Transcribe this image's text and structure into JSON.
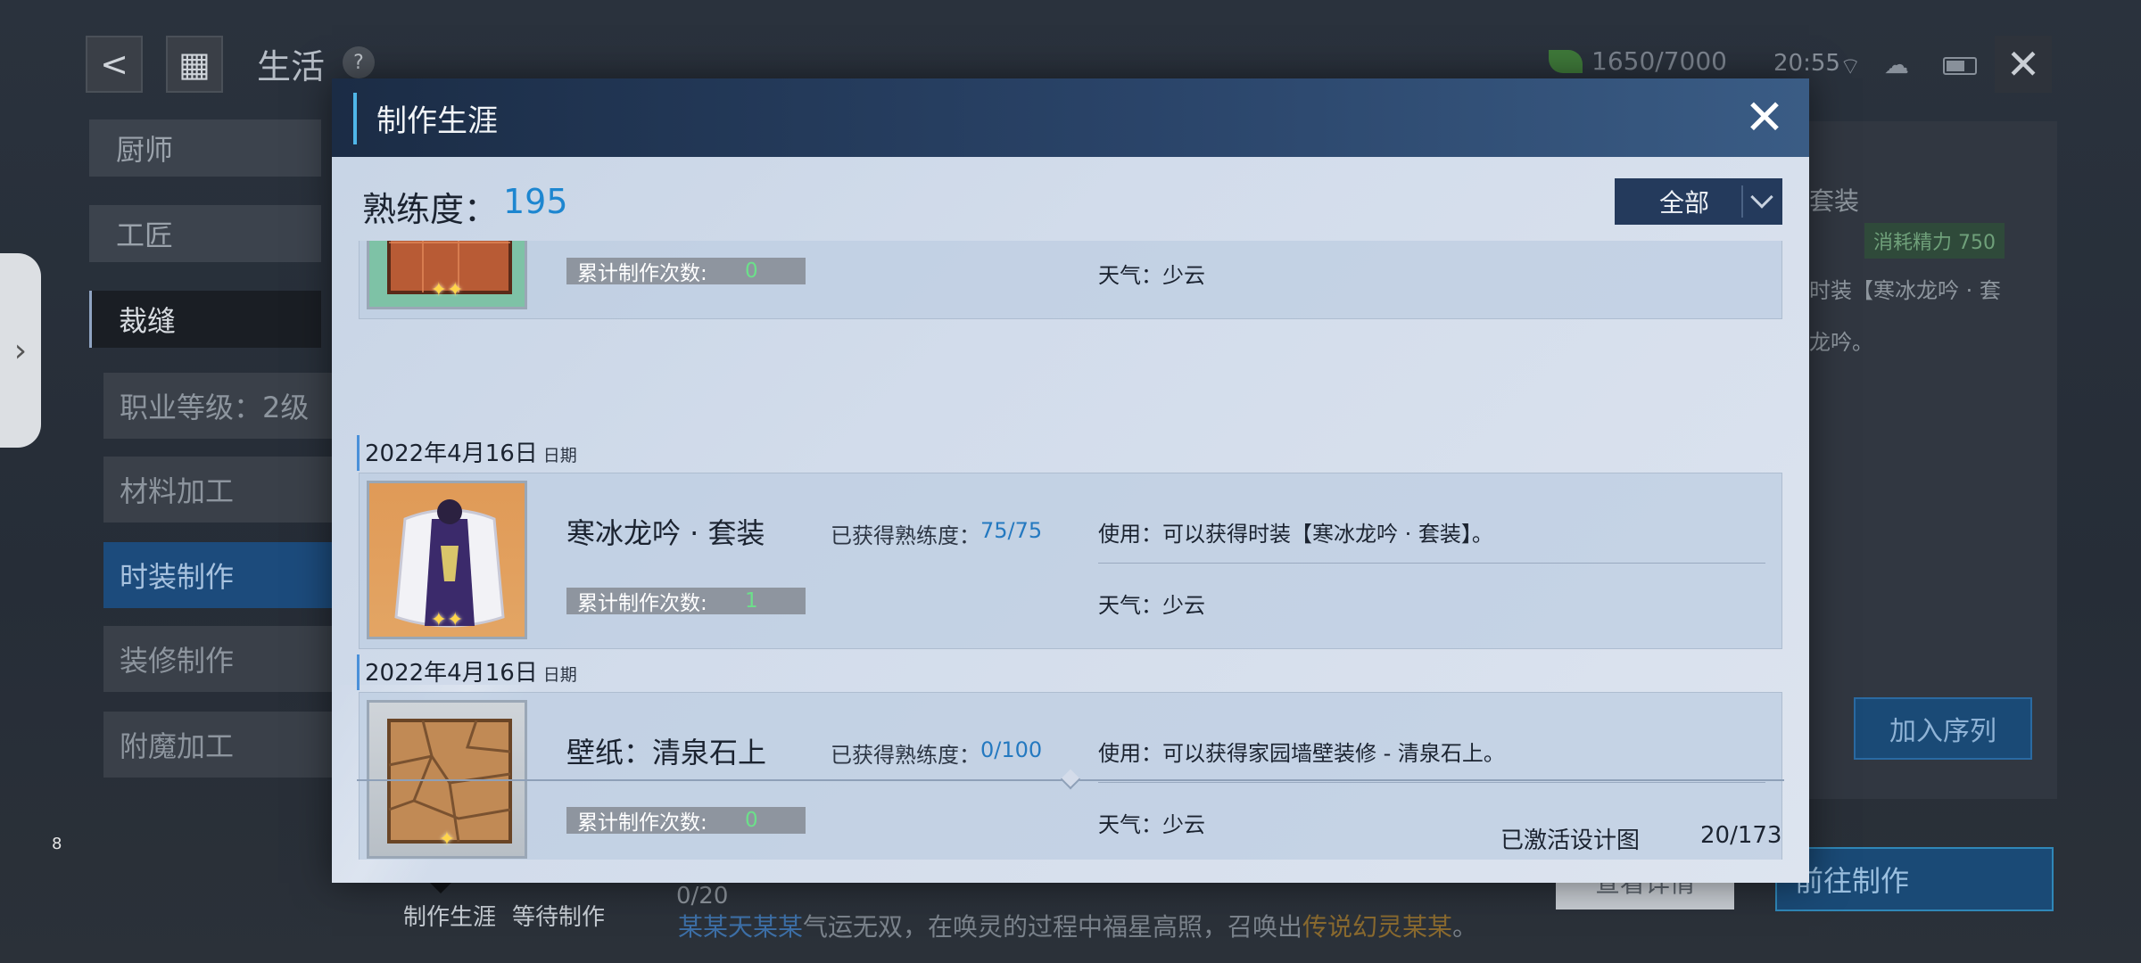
{
  "background": {
    "header": {
      "title": "生活",
      "help": "?",
      "energy": "1650/7000",
      "time": "20:55",
      "back_glyph": "<",
      "menu_glyph": "▦",
      "close_glyph": "✕"
    },
    "left_tabs": [
      {
        "label": "厨师"
      },
      {
        "label": "工匠"
      },
      {
        "label": "裁缝"
      }
    ],
    "left_subs": [
      {
        "label": "职业等级：2级"
      },
      {
        "label": "材料加工"
      },
      {
        "label": "时装制作"
      },
      {
        "label": "装修制作"
      },
      {
        "label": "附魔加工"
      }
    ],
    "side_handle_glyph": "›",
    "page_number": "8",
    "right_panel": {
      "title_fragment": "套装",
      "cost_label": "消耗精力 750",
      "desc_1": "时装【寒冰龙吟 · 套",
      "desc_2": "龙吟。",
      "add_queue": "加入序列",
      "go_make": "前往制作",
      "view_detail": "查看详情"
    },
    "bottom": {
      "tab_career": "制作生涯",
      "tab_waiting": "等待制作",
      "queue": "0/20",
      "ticker_parts": [
        "某某天某某",
        "气运无双，在唤灵的过程中福星高照，召唤出",
        "传说幻灵",
        "某某",
        "。"
      ]
    }
  },
  "modal": {
    "title": "制作生涯",
    "close_glyph": "✕",
    "proficiency_label": "熟练度：",
    "proficiency_value": "195",
    "filter_value": "全部",
    "entries": [
      {
        "date": "",
        "name": "",
        "gained_label": "",
        "gained_value": "",
        "use": "",
        "count_label": "累计制作次数:",
        "count_value": "0",
        "weather": "天气：少云",
        "stars": "✦✦"
      },
      {
        "date": "2022年4月16日",
        "date_suffix": "日期",
        "name": "寒冰龙吟 · 套装",
        "gained_label": "已获得熟练度：",
        "gained_value": "75/75",
        "use": "使用：可以获得时装【寒冰龙吟 · 套装】。",
        "count_label": "累计制作次数:",
        "count_value": "1",
        "weather": "天气：少云",
        "stars": "✦✦"
      },
      {
        "date": "2022年4月16日",
        "date_suffix": "日期",
        "name": "壁纸：清泉石上",
        "gained_label": "已获得熟练度：",
        "gained_value": "0/100",
        "use": "使用：可以获得家园墙壁装修 - 清泉石上。",
        "count_label": "累计制作次数:",
        "count_value": "0",
        "weather": "天气：少云",
        "stars": "✦"
      }
    ],
    "activated_label": "已激活设计图",
    "activated_value": "20/173"
  }
}
